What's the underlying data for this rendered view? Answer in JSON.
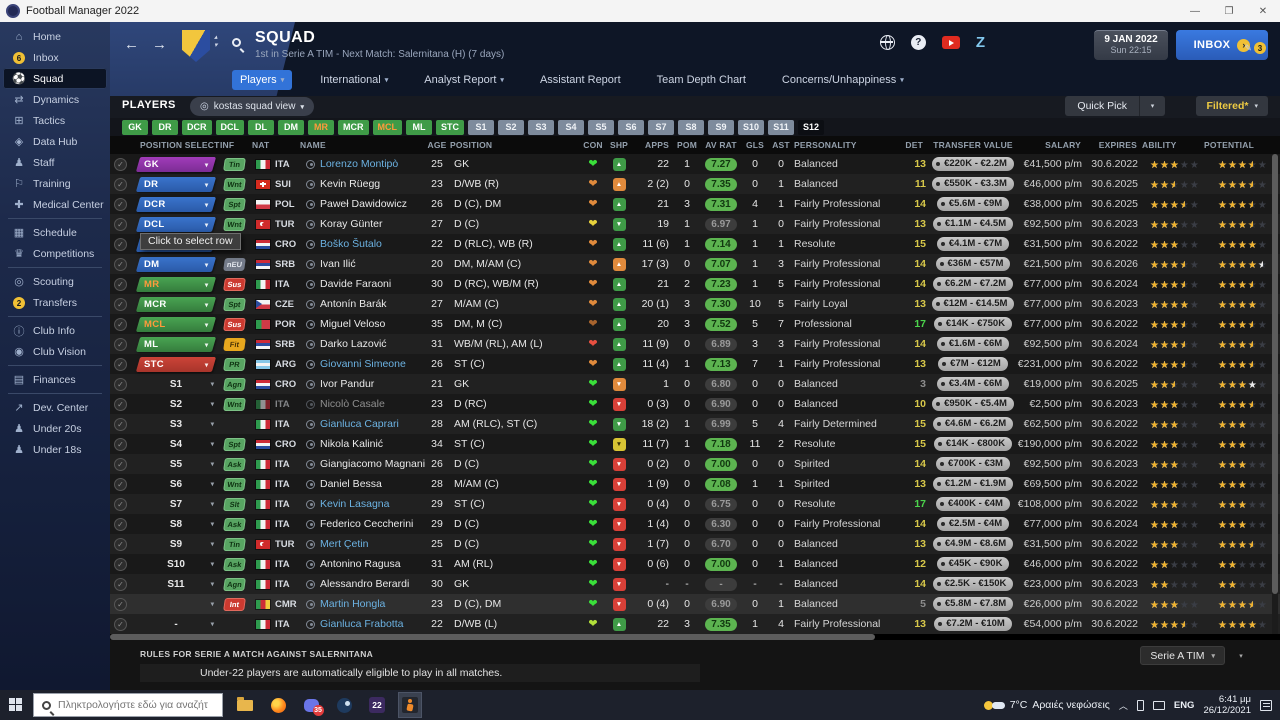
{
  "titlebar": {
    "title": "Football Manager 2022",
    "minimize": "—",
    "restore": "❐",
    "close": "✕"
  },
  "sidebar": {
    "items": [
      {
        "icon": "home-icon",
        "label": "Home"
      },
      {
        "icon": "inbox-icon",
        "label": "Inbox",
        "badge": "6"
      },
      {
        "icon": "squad-icon",
        "label": "Squad",
        "active": true
      },
      {
        "icon": "dynamics-icon",
        "label": "Dynamics"
      },
      {
        "icon": "tactics-icon",
        "label": "Tactics"
      },
      {
        "icon": "data-hub-icon",
        "label": "Data Hub"
      },
      {
        "icon": "staff-icon",
        "label": "Staff"
      },
      {
        "icon": "training-icon",
        "label": "Training"
      },
      {
        "icon": "medical-icon",
        "label": "Medical Center"
      },
      {
        "icon": "schedule-icon",
        "label": "Schedule",
        "divider": true
      },
      {
        "icon": "competitions-icon",
        "label": "Competitions"
      },
      {
        "icon": "scouting-icon",
        "label": "Scouting",
        "divider": true
      },
      {
        "icon": "transfers-icon",
        "label": "Transfers",
        "badge": "2"
      },
      {
        "icon": "club-info-icon",
        "label": "Club Info",
        "divider": true
      },
      {
        "icon": "club-vision-icon",
        "label": "Club Vision"
      },
      {
        "icon": "finances-icon",
        "label": "Finances",
        "divider": true
      },
      {
        "icon": "dev-center-icon",
        "label": "Dev. Center",
        "divider": true
      },
      {
        "icon": "under20-icon",
        "label": "Under 20s"
      },
      {
        "icon": "under18-icon",
        "label": "Under 18s"
      }
    ]
  },
  "header": {
    "title": "SQUAD",
    "subtitle": "1st in Serie A TIM - Next Match: Salernitana (H) (7 days)",
    "date": "9 JAN 2022",
    "daytime": "Sun 22:15",
    "inbox_label": "INBOX",
    "news_badge": "3",
    "accent_blue": "#3273d8"
  },
  "nav": {
    "tabs": [
      {
        "label": "Players",
        "caret": true,
        "active": true
      },
      {
        "label": "International",
        "caret": true
      },
      {
        "label": "Analyst Report",
        "caret": true
      },
      {
        "label": "Assistant Report"
      },
      {
        "label": "Team Depth Chart"
      },
      {
        "label": "Concerns/Unhappiness",
        "caret": true
      }
    ]
  },
  "toolbar": {
    "players_label": "PLAYERS",
    "view_name": "kostas squad view",
    "quick_pick": "Quick Pick",
    "filtered": "Filtered*"
  },
  "pos_filters": [
    {
      "label": "GK",
      "type": "green"
    },
    {
      "label": "DR",
      "type": "green"
    },
    {
      "label": "DCR",
      "type": "green"
    },
    {
      "label": "DCL",
      "type": "green"
    },
    {
      "label": "DL",
      "type": "green"
    },
    {
      "label": "DM",
      "type": "green"
    },
    {
      "label": "MR",
      "type": "green-warn"
    },
    {
      "label": "MCR",
      "type": "green"
    },
    {
      "label": "MCL",
      "type": "green-warn"
    },
    {
      "label": "ML",
      "type": "green"
    },
    {
      "label": "STC",
      "type": "green"
    },
    {
      "label": "S1",
      "type": "gray"
    },
    {
      "label": "S2",
      "type": "gray"
    },
    {
      "label": "S3",
      "type": "gray"
    },
    {
      "label": "S4",
      "type": "gray"
    },
    {
      "label": "S5",
      "type": "gray"
    },
    {
      "label": "S6",
      "type": "gray"
    },
    {
      "label": "S7",
      "type": "gray"
    },
    {
      "label": "S8",
      "type": "gray"
    },
    {
      "label": "S9",
      "type": "gray"
    },
    {
      "label": "S10",
      "type": "gray"
    },
    {
      "label": "S11",
      "type": "gray"
    },
    {
      "label": "S12",
      "type": "dark"
    }
  ],
  "table": {
    "sort_indicator": "▲",
    "tooltip": "Click to select row",
    "columns": [
      "POSITION SELECTED",
      "INF",
      "NAT",
      "NAME",
      "AGE",
      "POSITION",
      "CON",
      "SHP",
      "APPS",
      "POM",
      "AV RAT",
      "GLS",
      "AST",
      "PERSONALITY",
      "DET",
      "TRANSFER VALUE",
      "SALARY",
      "EXPIRES",
      "ABILITY",
      "POTENTIAL"
    ]
  },
  "players": [
    {
      "pos": "GK",
      "style": "purple",
      "inf": "Tin",
      "infs": "g",
      "nat": "ITA",
      "name": "Lorenzo Montipò",
      "link": 1,
      "age": "25",
      "position": "GK",
      "con": "green",
      "shp": "g",
      "dir": "u",
      "apps": "22",
      "pom": "1",
      "rat": "7.27",
      "ratG": 1,
      "gls": "0",
      "ast": "0",
      "pers": "Balanced",
      "det": "13",
      "detc": "y",
      "val": "€220K - €2.2M",
      "sal": "€41,500 p/m",
      "exp": "30.6.2022",
      "ab": 3,
      "po": 3.5,
      "pw": 0
    },
    {
      "pos": "DR",
      "style": "blue",
      "inf": "Wnt",
      "infs": "g",
      "nat": "SUI",
      "name": "Kevin Rüegg",
      "link": 0,
      "age": "23",
      "position": "D/WB (R)",
      "con": "orange",
      "shp": "o",
      "dir": "u",
      "apps": "2 (2)",
      "pom": "0",
      "rat": "7.35",
      "ratG": 1,
      "gls": "0",
      "ast": "1",
      "pers": "Balanced",
      "det": "11",
      "detc": "y",
      "val": "€550K - €3.3M",
      "sal": "€46,000 p/m",
      "exp": "30.6.2025",
      "ab": 2.5,
      "po": 3.5,
      "pw": 0
    },
    {
      "pos": "DCR",
      "style": "blue",
      "inf": "Spt",
      "infs": "g",
      "nat": "POL",
      "name": "Paweł Dawidowicz",
      "link": 0,
      "age": "26",
      "position": "D (C), DM",
      "con": "orange",
      "shp": "g",
      "dir": "u",
      "apps": "21",
      "pom": "3",
      "rat": "7.31",
      "ratG": 1,
      "gls": "4",
      "ast": "1",
      "pers": "Fairly Professional",
      "det": "14",
      "detc": "y",
      "val": "€5.6M - €9M",
      "sal": "€38,000 p/m",
      "exp": "30.6.2025",
      "ab": 3.5,
      "po": 3.5,
      "pw": 0
    },
    {
      "pos": "DCL",
      "style": "blue",
      "inf": "Wnt",
      "infs": "g",
      "nat": "TUR",
      "name": "Koray Günter",
      "link": 0,
      "age": "27",
      "position": "D (C)",
      "con": "yellow",
      "shp": "g",
      "dir": "d",
      "apps": "19",
      "pom": "1",
      "rat": "6.97",
      "ratG": 0,
      "gls": "1",
      "ast": "0",
      "pers": "Fairly Professional",
      "det": "13",
      "detc": "y",
      "val": "€1.1M - €4.5M",
      "sal": "€92,500 p/m",
      "exp": "30.6.2023",
      "ab": 3,
      "po": 3.5,
      "pw": 0
    },
    {
      "pos": "DL",
      "style": "blue",
      "inf": "",
      "infs": "",
      "nat": "CRO",
      "name": "Boško Šutalo",
      "link": 1,
      "age": "22",
      "position": "D (RLC), WB (R)",
      "con": "orange",
      "shp": "g",
      "dir": "u",
      "apps": "11 (6)",
      "pom": "1",
      "rat": "7.14",
      "ratG": 1,
      "gls": "1",
      "ast": "1",
      "pers": "Resolute",
      "det": "15",
      "detc": "y",
      "val": "€4.1M - €7M",
      "sal": "€31,500 p/m",
      "exp": "30.6.2022",
      "ab": 3,
      "po": 4,
      "pw": 0
    },
    {
      "pos": "DM",
      "style": "blue",
      "inf": "nEU",
      "infs": "n",
      "nat": "SRB",
      "name": "Ivan Ilić",
      "link": 0,
      "age": "20",
      "position": "DM, M/AM (C)",
      "con": "orange",
      "shp": "o",
      "dir": "u",
      "apps": "17 (3)",
      "pom": "0",
      "rat": "7.07",
      "ratG": 1,
      "gls": "1",
      "ast": "3",
      "pers": "Fairly Professional",
      "det": "14",
      "detc": "y",
      "val": "€36M - €57M",
      "sal": "€21,500 p/m",
      "exp": "30.6.2026",
      "ab": 3.5,
      "po": 4,
      "pw": 0.5
    },
    {
      "pos": "MR",
      "style": "greenw",
      "inf": "Sus",
      "infs": "r",
      "nat": "ITA",
      "name": "Davide Faraoni",
      "link": 0,
      "age": "30",
      "position": "D (RC), WB/M (R)",
      "con": "orange",
      "shp": "g",
      "dir": "u",
      "apps": "21",
      "pom": "2",
      "rat": "7.23",
      "ratG": 1,
      "gls": "1",
      "ast": "5",
      "pers": "Fairly Professional",
      "det": "14",
      "detc": "y",
      "val": "€6.2M - €7.2M",
      "sal": "€77,000 p/m",
      "exp": "30.6.2024",
      "ab": 3.5,
      "po": 3.5,
      "pw": 0
    },
    {
      "pos": "MCR",
      "style": "green",
      "inf": "Spt",
      "infs": "g",
      "nat": "CZE",
      "name": "Antonín Barák",
      "link": 0,
      "age": "27",
      "position": "M/AM (C)",
      "con": "orange",
      "shp": "g",
      "dir": "u",
      "apps": "20 (1)",
      "pom": "3",
      "rat": "7.30",
      "ratG": 1,
      "gls": "10",
      "ast": "5",
      "pers": "Fairly Loyal",
      "det": "13",
      "detc": "y",
      "val": "€12M - €14.5M",
      "sal": "€77,000 p/m",
      "exp": "30.6.2023",
      "ab": 4,
      "po": 4,
      "pw": 0
    },
    {
      "pos": "MCL",
      "style": "greenw",
      "inf": "Sus",
      "infs": "r",
      "nat": "POR",
      "name": "Miguel Veloso",
      "link": 0,
      "age": "35",
      "position": "DM, M (C)",
      "con": "brown",
      "shp": "g",
      "dir": "u",
      "apps": "20",
      "pom": "3",
      "rat": "7.52",
      "ratG": 1,
      "gls": "5",
      "ast": "7",
      "pers": "Professional",
      "det": "17",
      "detc": "g",
      "val": "€14K - €750K",
      "sal": "€77,000 p/m",
      "exp": "30.6.2022",
      "ab": 3.5,
      "po": 3.5,
      "pw": 0
    },
    {
      "pos": "ML",
      "style": "green",
      "inf": "Fit",
      "infs": "y",
      "nat": "SRB",
      "name": "Darko Lazović",
      "link": 0,
      "age": "31",
      "position": "WB/M (RL), AM (L)",
      "con": "red",
      "shp": "g",
      "dir": "u",
      "apps": "11 (9)",
      "pom": "0",
      "rat": "6.89",
      "ratG": 0,
      "gls": "3",
      "ast": "3",
      "pers": "Fairly Professional",
      "det": "14",
      "detc": "y",
      "val": "€1.6M - €6M",
      "sal": "€92,500 p/m",
      "exp": "30.6.2024",
      "ab": 3.5,
      "po": 3.5,
      "pw": 0
    },
    {
      "pos": "STC",
      "style": "red",
      "inf": "PR",
      "infs": "g",
      "nat": "ARG",
      "name": "Giovanni Simeone",
      "link": 1,
      "age": "26",
      "position": "ST (C)",
      "con": "orange",
      "shp": "g",
      "dir": "u",
      "apps": "11 (4)",
      "pom": "1",
      "rat": "7.13",
      "ratG": 1,
      "gls": "7",
      "ast": "1",
      "pers": "Fairly Professional",
      "det": "13",
      "detc": "y",
      "val": "€7M - €12M",
      "sal": "€231,000 p/m",
      "exp": "30.6.2022",
      "ab": 3.5,
      "po": 3.5,
      "pw": 0
    },
    {
      "pos": "S1",
      "style": "plain",
      "inf": "Agn",
      "infs": "g",
      "nat": "CRO",
      "name": "Ivor Pandur",
      "link": 0,
      "age": "21",
      "position": "GK",
      "con": "green",
      "shp": "o",
      "dir": "d",
      "apps": "1",
      "pom": "0",
      "rat": "6.80",
      "ratG": 0,
      "gls": "0",
      "ast": "0",
      "pers": "Balanced",
      "det": "3",
      "detc": "n",
      "val": "€3.4M - €6M",
      "sal": "€19,000 p/m",
      "exp": "30.6.2025",
      "ab": 2.5,
      "po": 3,
      "pw": 1
    },
    {
      "pos": "S2",
      "style": "plain",
      "inf": "Wnt",
      "infs": "g",
      "nat": "ITA",
      "name": "Nicolò Casale",
      "link": 0,
      "dim": 1,
      "age": "23",
      "position": "D (RC)",
      "con": "green",
      "shp": "r",
      "dir": "d",
      "apps": "0 (3)",
      "pom": "0",
      "rat": "6.90",
      "ratG": 0,
      "gls": "0",
      "ast": "0",
      "pers": "Balanced",
      "det": "10",
      "detc": "y",
      "val": "€950K - €5.4M",
      "sal": "€2,500 p/m",
      "exp": "30.6.2023",
      "ab": 3,
      "po": 3.5,
      "pw": 0
    },
    {
      "pos": "S3",
      "style": "plain",
      "inf": "",
      "infs": "",
      "nat": "ITA",
      "name": "Gianluca Caprari",
      "link": 1,
      "age": "28",
      "position": "AM (RLC), ST (C)",
      "con": "green",
      "shp": "g",
      "dir": "d",
      "apps": "18 (2)",
      "pom": "1",
      "rat": "6.99",
      "ratG": 0,
      "gls": "5",
      "ast": "4",
      "pers": "Fairly Determined",
      "det": "15",
      "detc": "y",
      "val": "€4.6M - €6.2M",
      "sal": "€62,500 p/m",
      "exp": "30.6.2022",
      "ab": 3,
      "po": 3,
      "pw": 0
    },
    {
      "pos": "S4",
      "style": "plain",
      "inf": "Spt",
      "infs": "g",
      "nat": "CRO",
      "name": "Nikola Kalinić",
      "link": 0,
      "age": "34",
      "position": "ST (C)",
      "con": "green",
      "shp": "y",
      "dir": "d",
      "apps": "11 (7)",
      "pom": "1",
      "rat": "7.18",
      "ratG": 1,
      "gls": "11",
      "ast": "2",
      "pers": "Resolute",
      "det": "15",
      "detc": "y",
      "val": "€14K - €800K",
      "sal": "€190,000 p/m",
      "exp": "30.6.2022",
      "ab": 3,
      "po": 3,
      "pw": 0
    },
    {
      "pos": "S5",
      "style": "plain",
      "inf": "Ask",
      "infs": "g",
      "nat": "ITA",
      "name": "Giangiacomo Magnani",
      "link": 0,
      "age": "26",
      "position": "D (C)",
      "con": "green",
      "shp": "r",
      "dir": "d",
      "apps": "0 (2)",
      "pom": "0",
      "rat": "7.00",
      "ratG": 1,
      "gls": "0",
      "ast": "0",
      "pers": "Spirited",
      "det": "14",
      "detc": "y",
      "val": "€700K - €3M",
      "sal": "€92,500 p/m",
      "exp": "30.6.2023",
      "ab": 3,
      "po": 3,
      "pw": 0
    },
    {
      "pos": "S6",
      "style": "plain",
      "inf": "Wnt",
      "infs": "g",
      "nat": "ITA",
      "name": "Daniel Bessa",
      "link": 0,
      "age": "28",
      "position": "M/AM (C)",
      "con": "green",
      "shp": "r",
      "dir": "d",
      "apps": "1 (9)",
      "pom": "0",
      "rat": "7.08",
      "ratG": 1,
      "gls": "1",
      "ast": "1",
      "pers": "Spirited",
      "det": "13",
      "detc": "y",
      "val": "€1.2M - €1.9M",
      "sal": "€69,500 p/m",
      "exp": "30.6.2022",
      "ab": 3,
      "po": 3,
      "pw": 0
    },
    {
      "pos": "S7",
      "style": "plain",
      "inf": "Slt",
      "infs": "g",
      "nat": "ITA",
      "name": "Kevin Lasagna",
      "link": 1,
      "age": "29",
      "position": "ST (C)",
      "con": "green",
      "shp": "r",
      "dir": "d",
      "apps": "0 (4)",
      "pom": "0",
      "rat": "6.75",
      "ratG": 0,
      "gls": "0",
      "ast": "0",
      "pers": "Resolute",
      "det": "17",
      "detc": "g",
      "val": "€400K - €4M",
      "sal": "€108,000 p/m",
      "exp": "30.6.2022",
      "ab": 3,
      "po": 3,
      "pw": 0
    },
    {
      "pos": "S8",
      "style": "plain",
      "inf": "Ask",
      "infs": "g",
      "nat": "ITA",
      "name": "Federico Ceccherini",
      "link": 0,
      "age": "29",
      "position": "D (C)",
      "con": "green",
      "shp": "r",
      "dir": "d",
      "apps": "1 (4)",
      "pom": "0",
      "rat": "6.30",
      "ratG": 0,
      "gls": "0",
      "ast": "0",
      "pers": "Fairly Professional",
      "det": "14",
      "detc": "y",
      "val": "€2.5M - €4M",
      "sal": "€77,000 p/m",
      "exp": "30.6.2024",
      "ab": 3,
      "po": 3,
      "pw": 0
    },
    {
      "pos": "S9",
      "style": "plain",
      "inf": "Tin",
      "infs": "g",
      "nat": "TUR",
      "name": "Mert Çetin",
      "link": 1,
      "age": "25",
      "position": "D (C)",
      "con": "green",
      "shp": "r",
      "dir": "d",
      "apps": "1 (7)",
      "pom": "0",
      "rat": "6.70",
      "ratG": 0,
      "gls": "0",
      "ast": "0",
      "pers": "Balanced",
      "det": "13",
      "detc": "y",
      "val": "€4.9M - €8.6M",
      "sal": "€31,500 p/m",
      "exp": "30.6.2022",
      "ab": 3,
      "po": 3.5,
      "pw": 0
    },
    {
      "pos": "S10",
      "style": "plain",
      "inf": "Ask",
      "infs": "g",
      "nat": "ITA",
      "name": "Antonino Ragusa",
      "link": 0,
      "age": "31",
      "position": "AM (RL)",
      "con": "green",
      "shp": "r",
      "dir": "d",
      "apps": "0 (6)",
      "pom": "0",
      "rat": "7.00",
      "ratG": 1,
      "gls": "0",
      "ast": "1",
      "pers": "Balanced",
      "det": "12",
      "detc": "y",
      "val": "€45K - €90K",
      "sal": "€46,000 p/m",
      "exp": "30.6.2022",
      "ab": 2,
      "po": 2,
      "pw": 0
    },
    {
      "pos": "S11",
      "style": "plain",
      "inf": "Agn",
      "infs": "g",
      "nat": "ITA",
      "name": "Alessandro Berardi",
      "link": 0,
      "age": "30",
      "position": "GK",
      "con": "green",
      "shp": "r",
      "dir": "d",
      "apps": "-",
      "pom": "-",
      "rat": "-",
      "ratG": 0,
      "gls": "-",
      "ast": "-",
      "pers": "Balanced",
      "det": "14",
      "detc": "y",
      "val": "€2.5K - €150K",
      "sal": "€23,000 p/m",
      "exp": "30.6.2023",
      "ab": 2,
      "po": 2,
      "pw": 0
    },
    {
      "pos": "",
      "style": "plain",
      "inf": "Int",
      "infs": "r",
      "nat": "CMR",
      "name": "Martin Hongla",
      "link": 1,
      "hl": 1,
      "age": "23",
      "position": "D (C), DM",
      "con": "green",
      "shp": "r",
      "dir": "d",
      "apps": "0 (4)",
      "pom": "0",
      "rat": "6.90",
      "ratG": 0,
      "gls": "0",
      "ast": "1",
      "pers": "Balanced",
      "det": "5",
      "detc": "n",
      "val": "€5.8M - €7.8M",
      "sal": "€26,000 p/m",
      "exp": "30.6.2022",
      "ab": 3,
      "po": 3.5,
      "pw": 0
    },
    {
      "pos": "-",
      "style": "plain",
      "inf": "",
      "infs": "",
      "nat": "ITA",
      "name": "Gianluca Frabotta",
      "link": 1,
      "age": "22",
      "position": "D/WB (L)",
      "con": "lime",
      "shp": "g",
      "dir": "u",
      "apps": "22",
      "pom": "3",
      "rat": "7.35",
      "ratG": 1,
      "gls": "1",
      "ast": "4",
      "pers": "Fairly Professional",
      "det": "13",
      "detc": "y",
      "val": "€7.2M - €10M",
      "sal": "€54,000 p/m",
      "exp": "30.6.2022",
      "ab": 3.5,
      "po": 4,
      "pw": 0
    }
  ],
  "footer": {
    "rules_title": "RULES FOR SERIE A MATCH AGAINST SALERNITANA",
    "rules_text": "Under-22 players are automatically eligible to play in all matches.",
    "competition": "Serie A TIM"
  },
  "taskbar": {
    "search_placeholder": "Πληκτρολογήστε εδώ για αναζήτηση",
    "discord_badge": "35",
    "fm_badge": "22",
    "weather_temp": "7°C",
    "weather_text": "Αραιές νεφώσεις",
    "lang": "ENG",
    "time": "6:41 μμ",
    "date": "26/12/2021"
  }
}
